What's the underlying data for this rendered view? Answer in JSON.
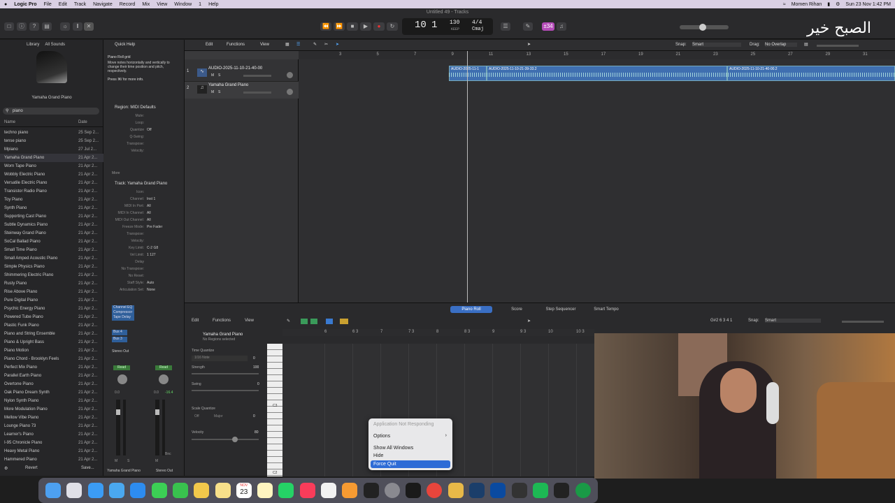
{
  "menubar": {
    "app": "Logic Pro",
    "items": [
      "File",
      "Edit",
      "Track",
      "Navigate",
      "Record",
      "Mix",
      "View",
      "Window",
      "1",
      "Help"
    ],
    "user": "Momen Rihan",
    "datetime": "Sun 23 Nov  1:42 PM"
  },
  "window": {
    "title": "Untitled 49 - Tracks"
  },
  "lcd": {
    "bar": "10",
    "beat": "1",
    "tempo": "130",
    "tempo_label": "KEEP",
    "signature": "4/4",
    "key": "Cmaj"
  },
  "badge": "±34",
  "watermark": "الصبح خير",
  "library": {
    "header": "Library",
    "filter": "All Sounds",
    "selected_name": "Yamaha Grand Piano",
    "search_value": "piano",
    "col_name": "Name",
    "col_date": "Date",
    "items": [
      {
        "name": "techno piano",
        "date": "25 Sep 2..."
      },
      {
        "name": "tense piano",
        "date": "25 Sep 2..."
      },
      {
        "name": "Mpiano",
        "date": "27 Jul 2..."
      },
      {
        "name": "Yamaha Grand Piano",
        "date": "21 Apr 2..."
      },
      {
        "name": "Worn Tape Piano",
        "date": "21 Apr 2..."
      },
      {
        "name": "Wobbly Electric Piano",
        "date": "21 Apr 2..."
      },
      {
        "name": "Versatile Electric Piano",
        "date": "21 Apr 2..."
      },
      {
        "name": "Transistor Radio Piano",
        "date": "21 Apr 2..."
      },
      {
        "name": "Toy Piano",
        "date": "21 Apr 2..."
      },
      {
        "name": "Synth Piano",
        "date": "21 Apr 2..."
      },
      {
        "name": "Supporting Cast Piano",
        "date": "21 Apr 2..."
      },
      {
        "name": "Subtle Dynamics Piano",
        "date": "21 Apr 2..."
      },
      {
        "name": "Steinway Grand Piano",
        "date": "21 Apr 2..."
      },
      {
        "name": "SoCal Ballad Piano",
        "date": "21 Apr 2..."
      },
      {
        "name": "Small Time Piano",
        "date": "21 Apr 2..."
      },
      {
        "name": "Small Amped Acoustic Piano",
        "date": "21 Apr 2..."
      },
      {
        "name": "Simple Physics Piano",
        "date": "21 Apr 2..."
      },
      {
        "name": "Shimmering Electric Piano",
        "date": "21 Apr 2..."
      },
      {
        "name": "Rusty Piano",
        "date": "21 Apr 2..."
      },
      {
        "name": "Rise Above Piano",
        "date": "21 Apr 2..."
      },
      {
        "name": "Pure Digital Piano",
        "date": "21 Apr 2..."
      },
      {
        "name": "Psychic Energy Piano",
        "date": "21 Apr 2..."
      },
      {
        "name": "Powered Tube Piano",
        "date": "21 Apr 2..."
      },
      {
        "name": "Plastic Funk Piano",
        "date": "21 Apr 2..."
      },
      {
        "name": "Piano and String Ensemble",
        "date": "21 Apr 2..."
      },
      {
        "name": "Piano & Upright Bass",
        "date": "21 Apr 2..."
      },
      {
        "name": "Piano Motion",
        "date": "21 Apr 2..."
      },
      {
        "name": "Piano Chord - Brooklyn Feels",
        "date": "21 Apr 2..."
      },
      {
        "name": "Perfect Mix Piano",
        "date": "21 Apr 2..."
      },
      {
        "name": "Parallel Earth Piano",
        "date": "21 Apr 2..."
      },
      {
        "name": "Overtone Piano",
        "date": "21 Apr 2..."
      },
      {
        "name": "Oak Piano Dream Synth",
        "date": "21 Apr 2..."
      },
      {
        "name": "Nylon Synth Piano",
        "date": "21 Apr 2..."
      },
      {
        "name": "More Modulation Piano",
        "date": "21 Apr 2..."
      },
      {
        "name": "Mellow Vibe Piano",
        "date": "21 Apr 2..."
      },
      {
        "name": "Lounge Piano 73",
        "date": "21 Apr 2..."
      },
      {
        "name": "Learner's Piano",
        "date": "21 Apr 2..."
      },
      {
        "name": "I-95 Chronicle Piano",
        "date": "21 Apr 2..."
      },
      {
        "name": "Heavy Metal Piano",
        "date": "21 Apr 2..."
      },
      {
        "name": "Hammered Piano",
        "date": "21 Apr 2..."
      }
    ],
    "revert": "Revert",
    "save": "Save..."
  },
  "inspector": {
    "quick_help": "Quick Help",
    "qh_title": "Piano Roll grid",
    "qh_text": "Move notes horizontally and vertically to change their time position and pitch, respectively.",
    "qh_more": "Press ⌘/ for more info.",
    "region_title": "Region: MIDI Defaults",
    "region_rows": [
      {
        "k": "Mute:",
        "v": ""
      },
      {
        "k": "Loop:",
        "v": ""
      },
      {
        "k": "Quantize",
        "v": "Off"
      },
      {
        "k": "Q-Swing:",
        "v": ""
      },
      {
        "k": "Transpose:",
        "v": ""
      },
      {
        "k": "Velocity:",
        "v": ""
      }
    ],
    "more": "More",
    "track_title": "Track: Yamaha Grand Piano",
    "track_rows": [
      {
        "k": "Icon:",
        "v": ""
      },
      {
        "k": "Channel:",
        "v": "Inst 1"
      },
      {
        "k": "MIDI In Port:",
        "v": "All"
      },
      {
        "k": "MIDI In Channel:",
        "v": "All"
      },
      {
        "k": "MIDI Out Channel:",
        "v": "All"
      },
      {
        "k": "Freeze Mode:",
        "v": "Pre Fader"
      },
      {
        "k": "Transpose:",
        "v": ""
      },
      {
        "k": "Velocity:",
        "v": ""
      },
      {
        "k": "Key Limit:",
        "v": "C-2  G8"
      },
      {
        "k": "Vel Limit:",
        "v": "1  127"
      },
      {
        "k": "Delay",
        "v": ""
      },
      {
        "k": "No Transpose:",
        "v": ""
      },
      {
        "k": "No Reset:",
        "v": ""
      },
      {
        "k": "Staff Style:",
        "v": "Auto"
      },
      {
        "k": "Articulation Set:",
        "v": "None"
      }
    ],
    "plugins": [
      "Channel EQ",
      "Compressor",
      "Tape Delay"
    ],
    "sends": [
      "Bus 4",
      "Bus 3"
    ],
    "output": "Stereo Out",
    "read1": "Read",
    "read2": "Read",
    "vol1": "0.0",
    "vol2": "0.0",
    "peak2": "-16.4",
    "strip1_name": "Yamaha Grand Piano",
    "strip2_name": "Stereo Out",
    "bnc": "Bnc",
    "m": "M",
    "s": "S"
  },
  "tracks_area": {
    "edit": "Edit",
    "functions": "Functions",
    "view": "View",
    "snap_label": "Snap:",
    "snap_value": "Smart",
    "drag_label": "Drag:",
    "drag_value": "No Overlap",
    "ruler": [
      "3",
      "5",
      "7",
      "9",
      "11",
      "13",
      "15",
      "17",
      "19",
      "21",
      "23",
      "25",
      "27",
      "29",
      "31"
    ],
    "tracks": [
      {
        "num": "1",
        "name": "AUDIO-2025-11-10-21-40-00"
      },
      {
        "num": "2",
        "name": "Yamaha Grand Piano"
      }
    ],
    "regions": [
      "AUDIO-2025-11-1",
      "AUDIO-2025-11-10-21-39-33.2",
      "AUDIO-2025-11-10-21-40-00.2"
    ]
  },
  "editor": {
    "tabs": [
      "Piano Roll",
      "Score",
      "Step Sequencer",
      "Smart Tempo"
    ],
    "edit": "Edit",
    "functions": "Functions",
    "view": "View",
    "position": "G#2  6 3 4 1",
    "snap_label": "Snap:",
    "snap_value": "Smart",
    "region_name": "Yamaha Grand Piano",
    "region_sub": "No Regions selected",
    "tq_label": "Time Quantize",
    "tq_value": "1/16 Note",
    "tq_num": "0",
    "strength_label": "Strength",
    "strength_value": "100",
    "swing_label": "Swing",
    "swing_value": "0",
    "sq_label": "Scale Quantize",
    "sq_off": "Off",
    "sq_major": "Major",
    "sq_num": "0",
    "velocity_label": "Velocity",
    "velocity_value": "80",
    "ruler": [
      "6",
      "6 3",
      "7",
      "7 3",
      "8",
      "8 3",
      "9",
      "9 3",
      "10",
      "10 3"
    ],
    "c3": "C3",
    "c2": "C2"
  },
  "context_menu": {
    "title": "Application Not Responding",
    "options": "Options",
    "show_all": "Show All Windows",
    "hide": "Hide",
    "force_quit": "Force Quit"
  },
  "dock": {
    "calendar_day": "23",
    "calendar_month": "NOV"
  }
}
